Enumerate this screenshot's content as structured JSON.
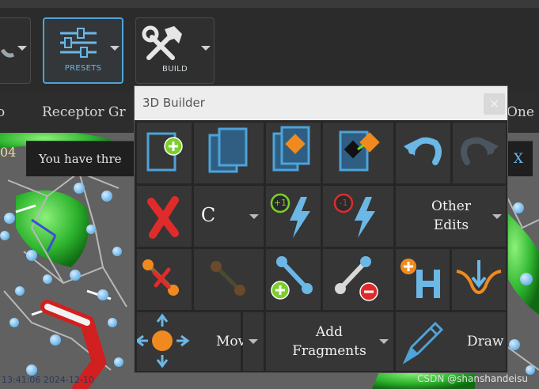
{
  "ribbon": {
    "presets_label": "PRESETS",
    "build_label": "BUILD"
  },
  "tabs": [
    "o",
    "Receptor Gr",
    "One"
  ],
  "message": {
    "left_number": "04",
    "text": "You have thre",
    "close_label": "X"
  },
  "dialog": {
    "title": "3D Builder",
    "close_label": "×",
    "element_symbol": "C",
    "other_edits_line1": "Other",
    "other_edits_line2": "Edits",
    "move_label": "Mov",
    "add_fragments_line1": "Add",
    "add_fragments_line2": "Fragments",
    "draw_label": "Draw",
    "increase_charge_badge": "+1",
    "decrease_charge_badge": "-1"
  },
  "footer": {
    "timestamp": "13:41:06 2024-12-10",
    "watermark": "CSDN @shanshandeisu"
  },
  "colors": {
    "accent_blue": "#4ea3d8",
    "orange": "#f08a1e",
    "red": "#e02b2b",
    "green": "#7ccf2a",
    "ribbon_bg": "#2b2b2b",
    "dialog_bg": "#262626",
    "cell_bg": "#363636"
  },
  "icons": {
    "new_icon": "new-document-plus-icon",
    "copy_icon": "copy-pages-icon",
    "replace_icon": "replace-fragment-icon",
    "transfer_icon": "transfer-fragment-icon",
    "undo_icon": "undo-arrow-icon",
    "redo_icon": "redo-arrow-icon",
    "delete_icon": "red-x-delete-icon",
    "delete_bond_icon": "delete-bond-icon",
    "bond_icon": "bond-icon",
    "add_bond_icon": "add-bond-icon",
    "remove_bond_icon": "remove-bond-icon",
    "add_hydrogen_icon": "add-hydrogen-icon",
    "minimize_icon": "minimize-curve-icon",
    "move_icon": "move-arrows-icon",
    "draw_icon": "pencil-icon"
  }
}
